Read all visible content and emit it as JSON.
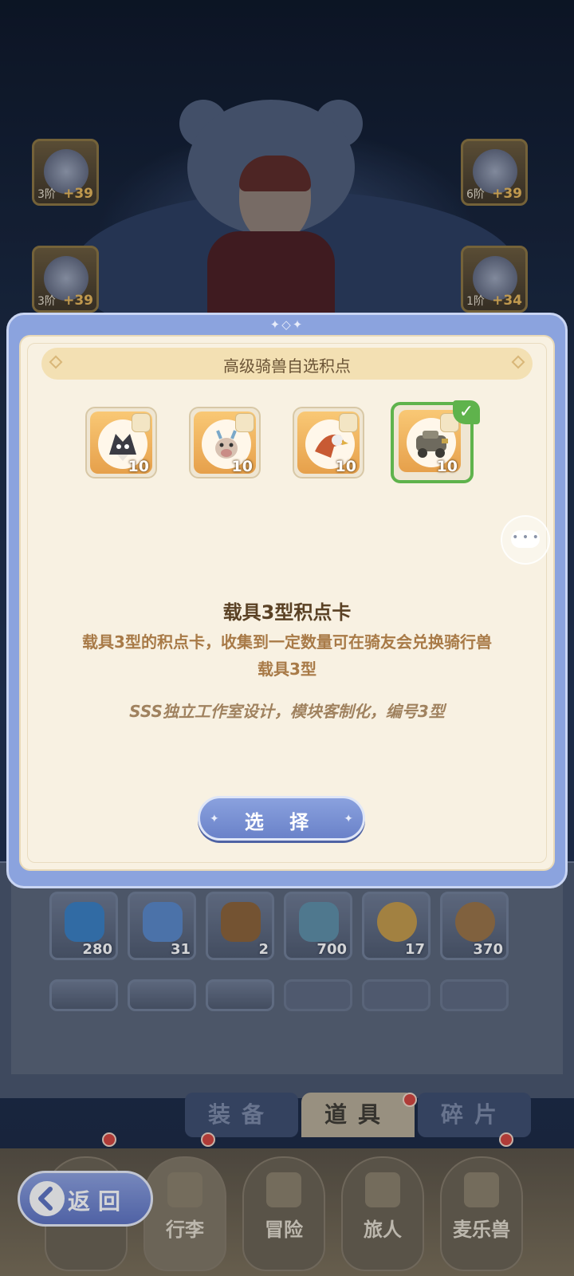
{
  "equipment_slots": [
    {
      "tier": "3阶",
      "bonus": "+39"
    },
    {
      "tier": "6阶",
      "bonus": "+39"
    },
    {
      "tier": "3阶",
      "bonus": "+39"
    },
    {
      "tier": "1阶",
      "bonus": "+34"
    }
  ],
  "inventory": {
    "items": [
      {
        "count": "280"
      },
      {
        "count": "31"
      },
      {
        "count": "2"
      },
      {
        "count": "700"
      },
      {
        "count": "17"
      },
      {
        "count": "370"
      }
    ]
  },
  "tabs": [
    {
      "label": "装备",
      "active": false
    },
    {
      "label": "道具",
      "active": true
    },
    {
      "label": "碎片",
      "active": false
    }
  ],
  "bottom_nav": [
    {
      "label": "",
      "icon": "crown-icon"
    },
    {
      "label": "行李",
      "icon": "luggage-icon"
    },
    {
      "label": "冒险",
      "icon": "crossed-swords-icon"
    },
    {
      "label": "旅人",
      "icon": "traveler-icon"
    },
    {
      "label": "麦乐兽",
      "icon": "cat-mount-icon"
    }
  ],
  "back_button": {
    "label": "返回"
  },
  "modal": {
    "title": "高级骑兽自选积点",
    "choices": [
      {
        "qty": "10",
        "icon": "wolf-mount-icon",
        "selected": false
      },
      {
        "qty": "10",
        "icon": "deer-mount-icon",
        "selected": false
      },
      {
        "qty": "10",
        "icon": "eagle-mount-icon",
        "selected": false
      },
      {
        "qty": "10",
        "icon": "vehicle-mount-icon",
        "selected": true
      }
    ],
    "check_mark": "✓",
    "item_name": "载具3型积点卡",
    "item_description": "载具3型的积点卡，收集到一定数量可在骑友会兑换骑行兽载具3型",
    "item_flavor": "SSS独立工作室设计，模块客制化，编号3型",
    "select_button": "选 择",
    "top_ornament": "✦◇✦"
  },
  "chat_icon": "chat-bubble-icon",
  "colors": {
    "modal_frame": "#8ba3de",
    "modal_body": "#f8f1e2",
    "selected_border": "#5fb34c",
    "button_blue": "#6a82c9",
    "text_brown": "#5a4124"
  }
}
